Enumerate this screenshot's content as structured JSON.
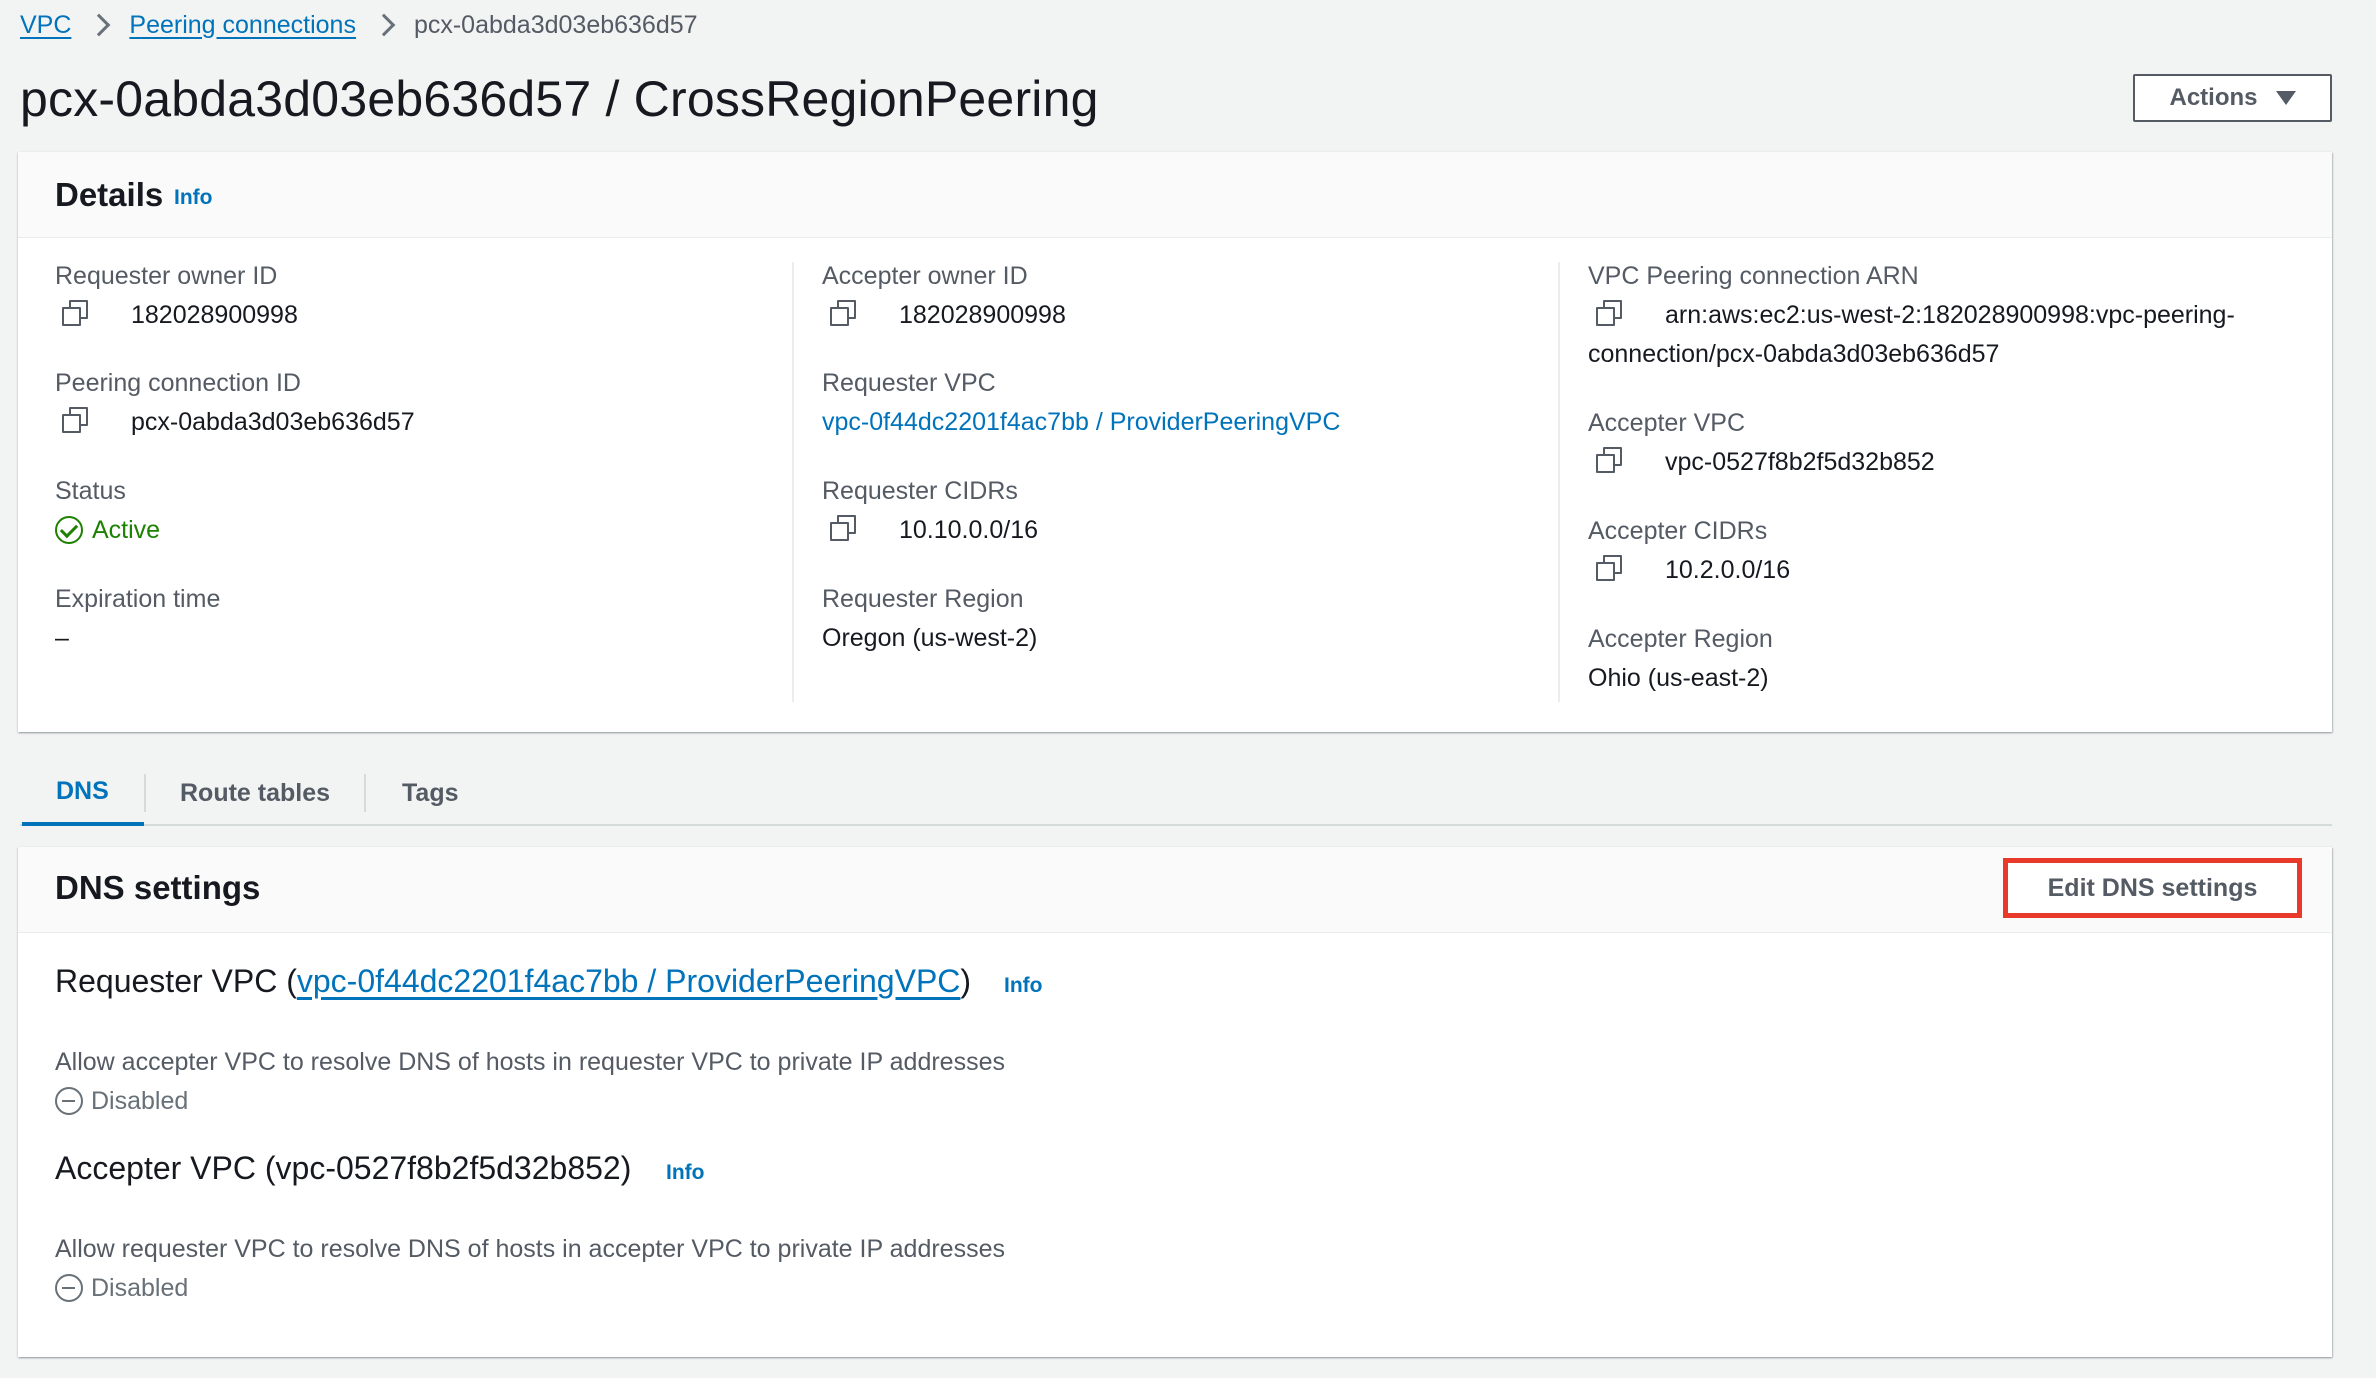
{
  "breadcrumb": {
    "items": [
      "VPC",
      "Peering connections"
    ],
    "current": "pcx-0abda3d03eb636d57"
  },
  "header": {
    "title": "pcx-0abda3d03eb636d57 / CrossRegionPeering",
    "actions_label": "Actions"
  },
  "details": {
    "title": "Details",
    "info": "Info",
    "col1": {
      "requester_owner_id": {
        "label": "Requester owner ID",
        "value": "182028900998"
      },
      "peering_connection_id": {
        "label": "Peering connection ID",
        "value": "pcx-0abda3d03eb636d57"
      },
      "status": {
        "label": "Status",
        "value": "Active"
      },
      "expiration_time": {
        "label": "Expiration time",
        "value": "–"
      }
    },
    "col2": {
      "accepter_owner_id": {
        "label": "Accepter owner ID",
        "value": "182028900998"
      },
      "requester_vpc": {
        "label": "Requester VPC",
        "value": "vpc-0f44dc2201f4ac7bb / ProviderPeeringVPC"
      },
      "requester_cidrs": {
        "label": "Requester CIDRs",
        "value": "10.10.0.0/16"
      },
      "requester_region": {
        "label": "Requester Region",
        "value": "Oregon (us-west-2)"
      }
    },
    "col3": {
      "arn": {
        "label": "VPC Peering connection ARN",
        "value_line1": "arn:aws:ec2:us-west-2:182028900998:vpc-peering-",
        "value_line2": "connection/pcx-0abda3d03eb636d57"
      },
      "accepter_vpc": {
        "label": "Accepter VPC",
        "value": "vpc-0527f8b2f5d32b852"
      },
      "accepter_cidrs": {
        "label": "Accepter CIDRs",
        "value": "10.2.0.0/16"
      },
      "accepter_region": {
        "label": "Accepter Region",
        "value": "Ohio (us-east-2)"
      }
    }
  },
  "tabs": [
    {
      "label": "DNS",
      "active": true
    },
    {
      "label": "Route tables",
      "active": false
    },
    {
      "label": "Tags",
      "active": false
    }
  ],
  "dns": {
    "title": "DNS settings",
    "edit_label": "Edit DNS settings",
    "requester": {
      "prefix": "Requester VPC (",
      "link": "vpc-0f44dc2201f4ac7bb / ProviderPeeringVPC",
      "suffix": ")",
      "info": "Info",
      "setting_label": "Allow accepter VPC to resolve DNS of hosts in requester VPC to private IP addresses",
      "setting_value": "Disabled"
    },
    "accepter": {
      "title": "Accepter VPC (vpc-0527f8b2f5d32b852)",
      "info": "Info",
      "setting_label": "Allow requester VPC to resolve DNS of hosts in accepter VPC to private IP addresses",
      "setting_value": "Disabled"
    }
  },
  "colors": {
    "link": "#0073bb",
    "success": "#1d8102",
    "highlight": "#e8392b",
    "muted": "#545b64"
  },
  "icons": [
    "chevron-right-icon",
    "caret-down-icon",
    "copy-icon",
    "status-success-icon",
    "status-disabled-icon"
  ]
}
